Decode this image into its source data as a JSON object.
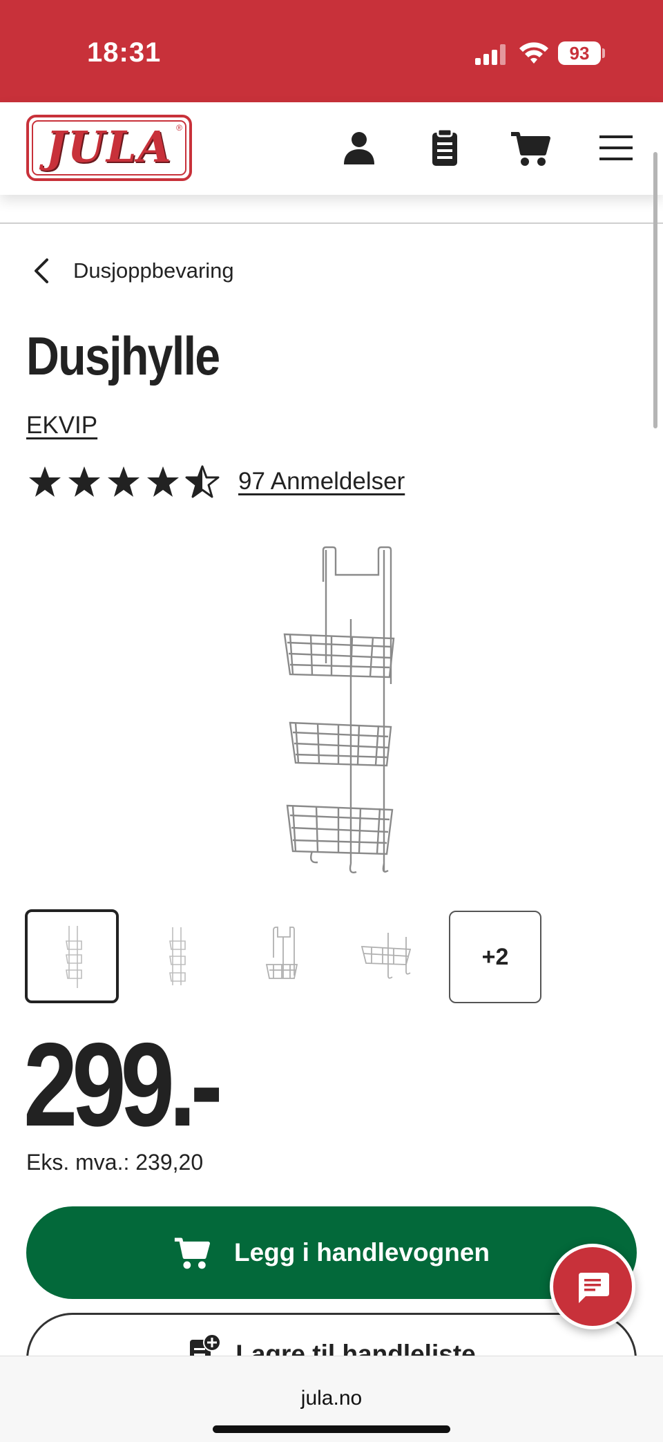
{
  "status_bar": {
    "time": "18:31",
    "battery": "93"
  },
  "header": {
    "logo_text": "JULA",
    "icons": [
      "account-icon",
      "shopping-list-icon",
      "cart-icon",
      "menu-icon"
    ]
  },
  "breadcrumb": {
    "label": "Dusjoppbevaring"
  },
  "product": {
    "title": "Dusjhylle",
    "brand": "EKVIP",
    "rating": 4.5,
    "reviews_label": "97 Anmeldelser",
    "price": "299.-",
    "ex_vat": "Eks. mva.: 239,20",
    "thumbnails_more": "+2"
  },
  "actions": {
    "add_to_cart": "Legg i handlevognen",
    "save_to_list": "Lagre til handleliste"
  },
  "browser": {
    "url": "jula.no"
  },
  "colors": {
    "brand_red": "#c8313a",
    "cta_green": "#03693a",
    "text": "#222222"
  }
}
